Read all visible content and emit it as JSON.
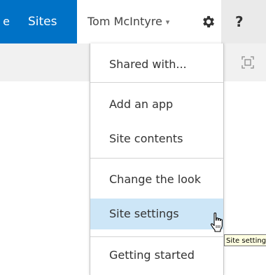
{
  "suitebar": {
    "truncated_link": "e",
    "sites_label": "Sites",
    "user_name": "Tom McIntyre",
    "user_caret": "▾",
    "help_label": "?"
  },
  "menu": {
    "items": [
      {
        "label": "Shared with..."
      },
      {
        "label": "Add an app"
      },
      {
        "label": "Site contents"
      },
      {
        "label": "Change the look"
      },
      {
        "label": "Site settings"
      },
      {
        "label": "Getting started"
      }
    ]
  },
  "tooltip": {
    "text": "Site settings"
  },
  "icons": {
    "gear": "gear-icon",
    "focus": "focus-on-content-icon",
    "cursor": "hand-pointer-icon"
  },
  "colors": {
    "brand_blue": "#0072c6",
    "hover": "#cde6f7",
    "tooltip_bg": "#ffffe1"
  }
}
